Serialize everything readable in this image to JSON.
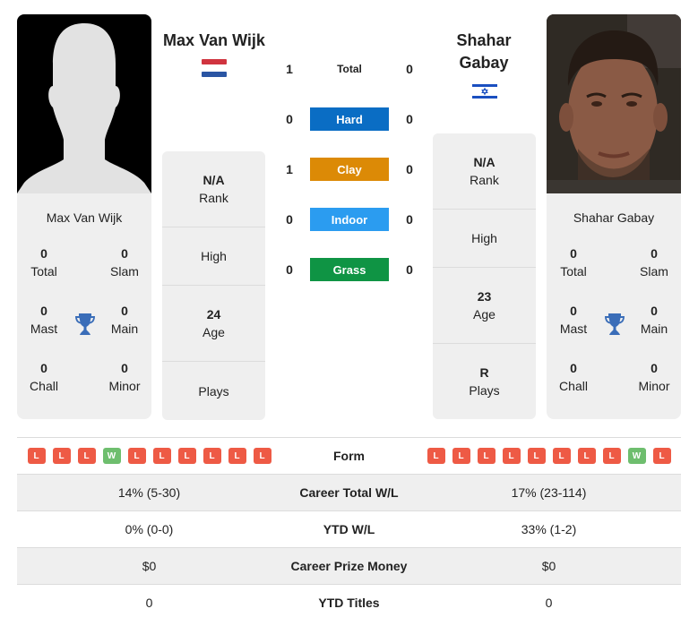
{
  "colors": {
    "hard": "#0a6dc4",
    "clay": "#dc8a06",
    "indoor": "#2b9cf0",
    "grass": "#0f9444",
    "loss": "#ee5a45",
    "win": "#6ebe6e",
    "trophy": "#3a6db8"
  },
  "player1": {
    "name": "Max Van Wijk",
    "flag": "netherlands-flag",
    "photo": "silhouette-placeholder",
    "titles": {
      "total": {
        "value": "0",
        "label": "Total"
      },
      "slam": {
        "value": "0",
        "label": "Slam"
      },
      "mast": {
        "value": "0",
        "label": "Mast"
      },
      "main": {
        "value": "0",
        "label": "Main"
      },
      "chall": {
        "value": "0",
        "label": "Chall"
      },
      "minor": {
        "value": "0",
        "label": "Minor"
      }
    },
    "info": {
      "rank": {
        "value": "N/A",
        "label": "Rank"
      },
      "high": {
        "value": "",
        "label": "High"
      },
      "age": {
        "value": "24",
        "label": "Age"
      },
      "plays": {
        "value": "",
        "label": "Plays"
      }
    },
    "form": [
      "L",
      "L",
      "L",
      "W",
      "L",
      "L",
      "L",
      "L",
      "L",
      "L"
    ]
  },
  "player2": {
    "name": "Shahar Gabay",
    "name_line1": "Shahar",
    "name_line2": "Gabay",
    "flag": "israel-flag",
    "photo": "player-photo",
    "titles": {
      "total": {
        "value": "0",
        "label": "Total"
      },
      "slam": {
        "value": "0",
        "label": "Slam"
      },
      "mast": {
        "value": "0",
        "label": "Mast"
      },
      "main": {
        "value": "0",
        "label": "Main"
      },
      "chall": {
        "value": "0",
        "label": "Chall"
      },
      "minor": {
        "value": "0",
        "label": "Minor"
      }
    },
    "info": {
      "rank": {
        "value": "N/A",
        "label": "Rank"
      },
      "high": {
        "value": "",
        "label": "High"
      },
      "age": {
        "value": "23",
        "label": "Age"
      },
      "plays": {
        "value": "R",
        "label": "Plays"
      }
    },
    "form": [
      "L",
      "L",
      "L",
      "L",
      "L",
      "L",
      "L",
      "L",
      "W",
      "L"
    ]
  },
  "h2h": [
    {
      "label": "Total",
      "p1": "1",
      "p2": "0",
      "style": "plain"
    },
    {
      "label": "Hard",
      "p1": "0",
      "p2": "0",
      "style": "hard"
    },
    {
      "label": "Clay",
      "p1": "1",
      "p2": "0",
      "style": "clay"
    },
    {
      "label": "Indoor",
      "p1": "0",
      "p2": "0",
      "style": "indoor"
    },
    {
      "label": "Grass",
      "p1": "0",
      "p2": "0",
      "style": "grass"
    }
  ],
  "stats": {
    "form_label": "Form",
    "rows": [
      {
        "label": "Career Total W/L",
        "p1": "14% (5-30)",
        "p2": "17% (23-114)"
      },
      {
        "label": "YTD W/L",
        "p1": "0% (0-0)",
        "p2": "33% (1-2)"
      },
      {
        "label": "Career Prize Money",
        "p1": "$0",
        "p2": "$0"
      },
      {
        "label": "YTD Titles",
        "p1": "0",
        "p2": "0"
      }
    ]
  }
}
